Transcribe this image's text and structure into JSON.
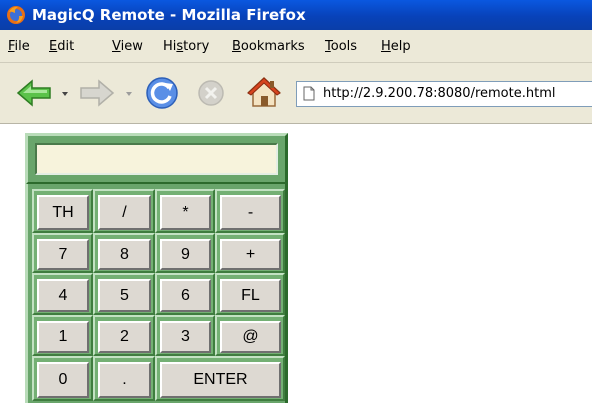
{
  "window": {
    "title": "MagicQ Remote - Mozilla Firefox"
  },
  "menu": {
    "items": [
      {
        "pre": "",
        "acc": "F",
        "post": "ile"
      },
      {
        "pre": "",
        "acc": "E",
        "post": "dit"
      },
      {
        "pre": "",
        "acc": "V",
        "post": "iew"
      },
      {
        "pre": "Hi",
        "acc": "s",
        "post": "tory"
      },
      {
        "pre": "",
        "acc": "B",
        "post": "ookmarks"
      },
      {
        "pre": "",
        "acc": "T",
        "post": "ools"
      },
      {
        "pre": "",
        "acc": "H",
        "post": "elp"
      }
    ]
  },
  "nav": {
    "icons": [
      "back-arrow-icon",
      "forward-arrow-icon",
      "reload-icon",
      "stop-icon",
      "home-icon",
      "page-icon"
    ],
    "url": "http://2.9.200.78:8080/remote.html"
  },
  "remote": {
    "entry_value": "",
    "colors": {
      "panel": "#69a56b",
      "entry_bg": "#f7f3dc",
      "key_bg": "#ddd9d2"
    },
    "keys": [
      [
        "TH",
        "/",
        "*",
        "-"
      ],
      [
        "7",
        "8",
        "9",
        "+"
      ],
      [
        "4",
        "5",
        "6",
        "FL"
      ],
      [
        "1",
        "2",
        "3",
        "@"
      ],
      [
        "0",
        ".",
        "ENTER"
      ]
    ]
  }
}
